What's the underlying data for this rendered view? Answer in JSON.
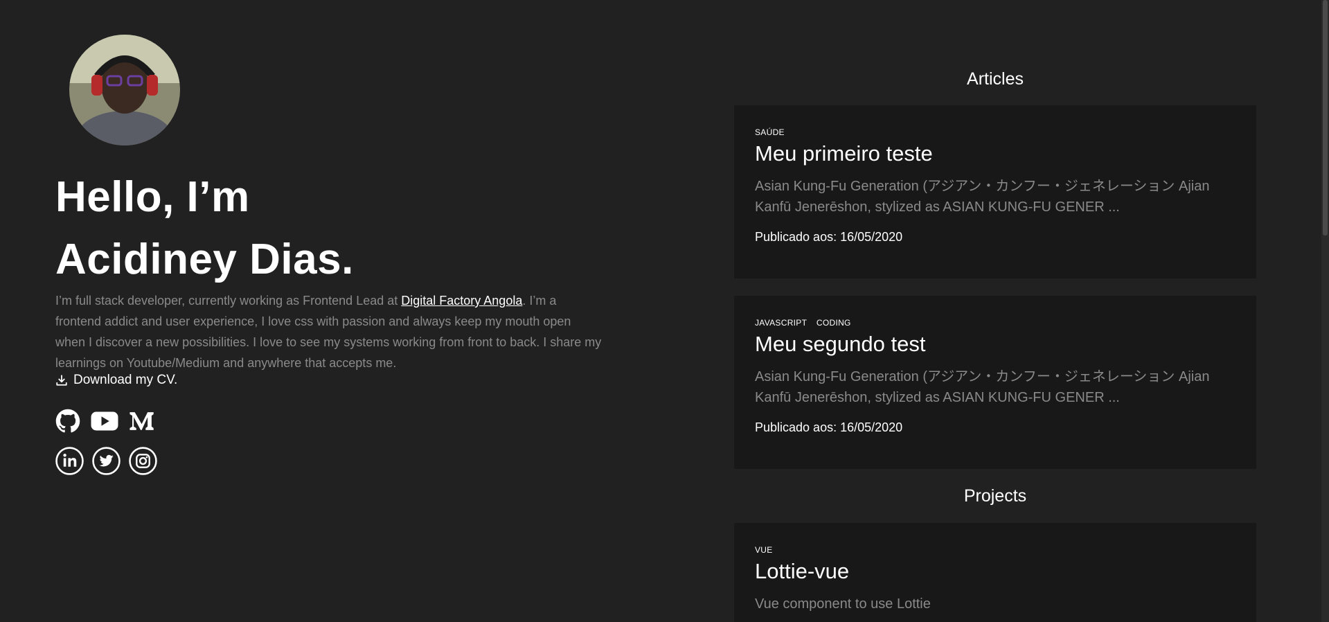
{
  "profile": {
    "hello_line1": "Hello, I’m",
    "hello_line2": "Acidiney Dias.",
    "bio_before_link": "I’m full stack developer, currently working as Frontend Lead at ",
    "bio_link": "Digital Factory Angola",
    "bio_after_link": ". I’m a frontend addict and user experience, I love css with passion and always keep my mouth open when I discover a new possibilities. I love to see my systems working from front to back. I share my learnings on Youtube/Medium and anywhere that accepts me.",
    "download_label": "Download my CV."
  },
  "socials": [
    "github-icon",
    "youtube-icon",
    "medium-icon",
    "linkedin-icon",
    "twitter-icon",
    "instagram-icon"
  ],
  "articles": {
    "title": "Articles",
    "items": [
      {
        "tags": [
          "SAÚDE"
        ],
        "title": "Meu primeiro teste",
        "excerpt": "Asian Kung-Fu Generation (アジアン・カンフー・ジェネレーション Ajian Kanfū Jenerēshon, stylized as ASIAN KUNG-FU GENER ...",
        "date": "Publicado aos: 16/05/2020"
      },
      {
        "tags": [
          "JAVASCRIPT",
          "CODING"
        ],
        "title": "Meu segundo test",
        "excerpt": "Asian Kung-Fu Generation (アジアン・カンフー・ジェネレーション Ajian Kanfū Jenerēshon, stylized as ASIAN KUNG-FU GENER ...",
        "date": "Publicado aos: 16/05/2020"
      }
    ]
  },
  "projects": {
    "title": "Projects",
    "items": [
      {
        "tags": [
          "VUE"
        ],
        "title": "Lottie-vue",
        "excerpt": "Vue component to use Lottie"
      }
    ]
  },
  "colors": {
    "background": "#212121",
    "card": "#181818",
    "muted_text": "#8a8a8a",
    "text": "#ffffff"
  }
}
